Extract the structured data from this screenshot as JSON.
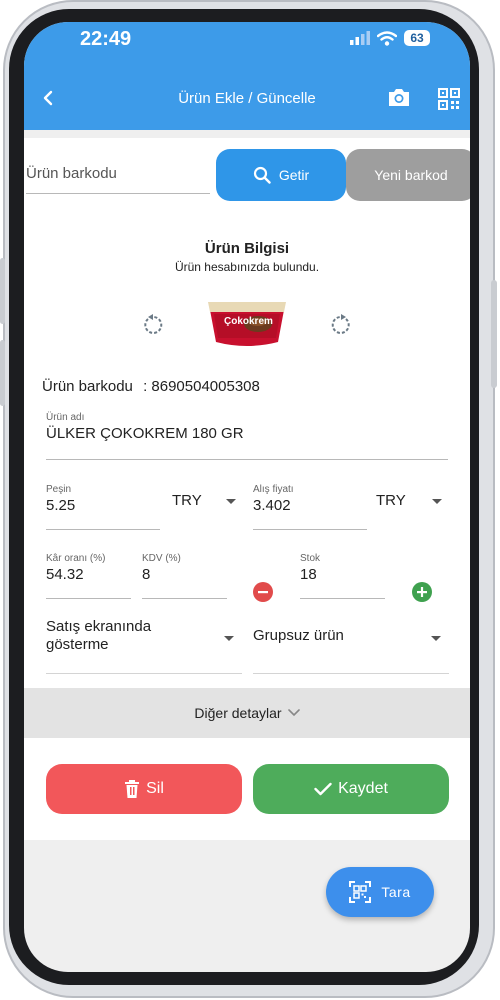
{
  "status_bar": {
    "time": "22:49",
    "battery": "63"
  },
  "app_bar": {
    "title": "Ürün Ekle / Güncelle"
  },
  "search": {
    "placeholder": "Ürün barkodu",
    "fetch_label": "Getir",
    "new_barcode_label": "Yeni barkod"
  },
  "product": {
    "heading": "Ürün Bilgisi",
    "subheading": "Ürün hesabınızda bulundu.",
    "image_brand_text": "Çokokrem",
    "barcode_label": "Ürün barkodu",
    "barcode_value": ": 8690504005308",
    "name": {
      "label": "Ürün adı",
      "value": "ÜLKER ÇOKOKREM 180 GR"
    },
    "cash_price": {
      "label": "Peşin",
      "value": "5.25",
      "currency": "TRY"
    },
    "purchase_price": {
      "label": "Alış fiyatı",
      "value": "3.402",
      "currency": "TRY"
    },
    "profit_rate": {
      "label": "Kâr oranı (%)",
      "value": "54.32"
    },
    "vat": {
      "label": "KDV (%)",
      "value": "8"
    },
    "stock": {
      "label": "Stok",
      "value": "18"
    },
    "sales_screen": {
      "value": "Satış ekranında gösterme"
    },
    "group": {
      "value": "Grupsuz ürün"
    }
  },
  "details": {
    "label": "Diğer detaylar"
  },
  "actions": {
    "delete_label": "Sil",
    "save_label": "Kaydet",
    "scan_label": "Tara"
  },
  "colors": {
    "app_bar": "#3d9be9",
    "delete": "#f2575a",
    "save": "#4eac5b",
    "secondary": "#9e9e9e"
  }
}
